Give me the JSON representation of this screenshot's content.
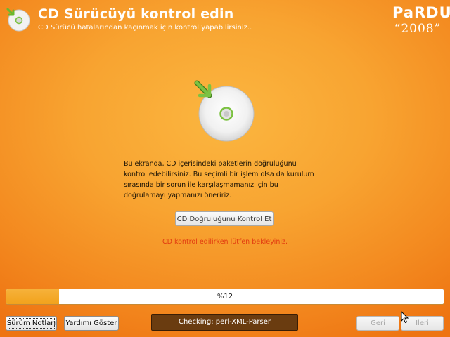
{
  "header": {
    "title": "CD Sürücüyü kontrol edin",
    "subtitle": "CD Sürücü hatalarından kaçınmak için kontrol yapabilirsiniz..",
    "icon": "cd-check-icon"
  },
  "logo": {
    "brand": "PaRDUS",
    "year": "“2008”"
  },
  "main": {
    "icon": "cd-check-icon",
    "description": "Bu ekranda, CD içerisindeki paketlerin doğruluğunu\nkontrol edebilirsiniz. Bu seçimli bir işlem olsa da kurulum\nsırasında bir sorun ile karşılaşmamanız için bu\ndoğrulamayı yapmanızı öneririz.",
    "verify_button": "CD Doğruluğunu Kontrol Et",
    "status_message": "CD kontrol edilirken lütfen bekleyiniz."
  },
  "progress": {
    "value": 0.12,
    "label": "%12"
  },
  "footer": {
    "release_notes": "Sürüm Notları",
    "show_help": "Yardımı Göster",
    "checking": "Checking: perl-XML-Parser",
    "back": "Geri",
    "next": "İleri"
  },
  "colors": {
    "accent_green": "#6ab82e",
    "status_red": "#e23b10",
    "progress_fill": "#f2a21c",
    "checking_bg": "#6a3c10"
  }
}
